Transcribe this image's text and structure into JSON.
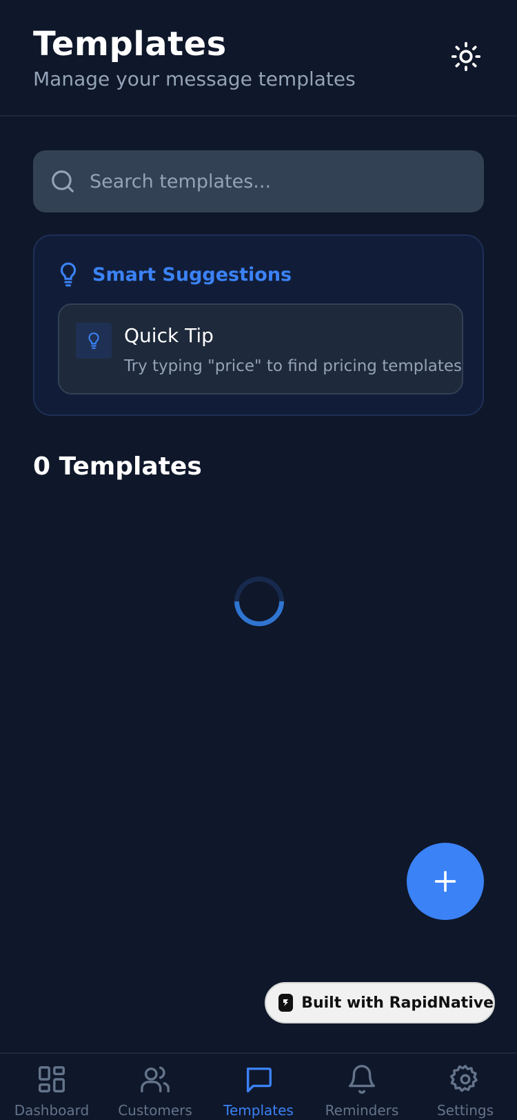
{
  "header": {
    "title": "Templates",
    "subtitle": "Manage your message templates",
    "theme_icon": "sun-icon"
  },
  "search": {
    "placeholder": "Search templates...",
    "value": "",
    "icon": "search-icon"
  },
  "suggestions": {
    "title": "Smart Suggestions",
    "icon": "lightbulb-icon",
    "tip": {
      "title": "Quick Tip",
      "text": "Try typing \"price\" to find pricing templates"
    }
  },
  "templates": {
    "count_label": "0 Templates",
    "loading": true
  },
  "fab": {
    "icon": "plus-icon"
  },
  "badge": {
    "label": "Built with RapidNative"
  },
  "tabbar": {
    "items": [
      {
        "label": "Dashboard",
        "icon": "grid-icon",
        "active": false
      },
      {
        "label": "Customers",
        "icon": "users-icon",
        "active": false
      },
      {
        "label": "Templates",
        "icon": "message-icon",
        "active": true
      },
      {
        "label": "Reminders",
        "icon": "bell-icon",
        "active": false
      },
      {
        "label": "Settings",
        "icon": "gear-icon",
        "active": false
      }
    ]
  },
  "colors": {
    "background": "#0f172a",
    "accent": "#3b82f6",
    "muted_text": "#94a3b8",
    "input_bg": "#334155"
  }
}
